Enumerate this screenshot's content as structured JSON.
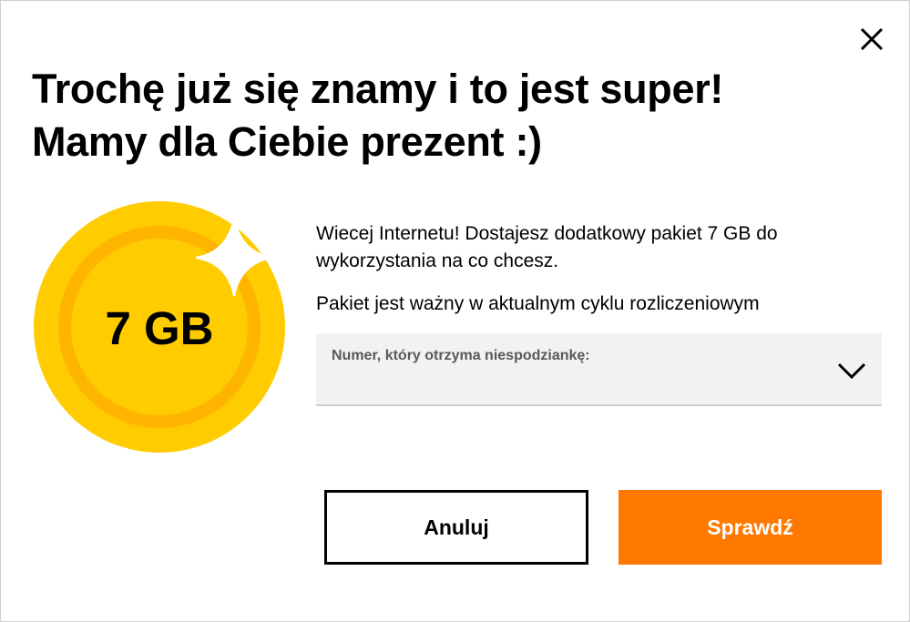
{
  "dialog": {
    "title_line1": "Trochę już się znamy i to jest super!",
    "title_line2": "Mamy dla Ciebie prezent :)",
    "close_icon": "close-icon"
  },
  "gift": {
    "amount_label": "7 GB",
    "icon": "coin-with-sparkle-icon",
    "colors": {
      "coin_outer": "#ffcc00",
      "coin_ring": "#ffb400",
      "sparkle": "#ffffff"
    }
  },
  "content": {
    "description": "Wiecej Internetu! Dostajesz dodatkowy pakiet 7 GB do wykorzystania na co chcesz.",
    "validity": "Pakiet jest ważny w aktualnym cyklu rozliczeniowym"
  },
  "number_select": {
    "label": "Numer, który otrzyma niespodziankę:",
    "value": "",
    "icon": "chevron-down-icon"
  },
  "actions": {
    "cancel_label": "Anuluj",
    "check_label": "Sprawdź"
  },
  "colors": {
    "accent": "#ff7900",
    "text": "#000000",
    "field_bg": "#f2f2f2"
  }
}
